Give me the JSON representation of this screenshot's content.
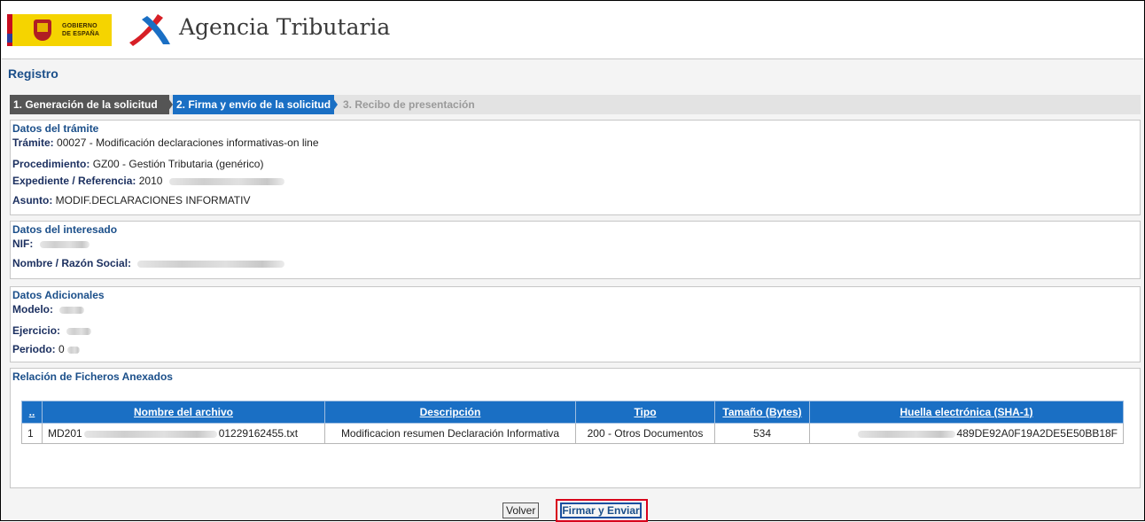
{
  "header": {
    "gov_text": [
      "GOBIERNO",
      "DE ESPAÑA"
    ],
    "brand": "Agencia Tributaria",
    "brand_color": "#1a6fc4"
  },
  "page_title": "Registro",
  "steps": [
    {
      "label": "1. Generación de la solicitud",
      "state": "done"
    },
    {
      "label": "2. Firma y envío de la solicitud",
      "state": "active"
    },
    {
      "label": "3. Recibo de presentación",
      "state": "pending"
    }
  ],
  "tramite": {
    "title": "Datos del trámite",
    "tramite_label": "Trámite:",
    "tramite_value": "00027 - Modificación declaraciones informativas-on line",
    "procedimiento_label": "Procedimiento:",
    "procedimiento_value": "GZ00 - Gestión Tributaria (genérico)",
    "expediente_label": "Expediente / Referencia:",
    "expediente_value": "2010",
    "asunto_label": "Asunto:",
    "asunto_value": "MODIF.DECLARACIONES INFORMATIV"
  },
  "interesado": {
    "title": "Datos del interesado",
    "nif_label": "NIF:",
    "nombre_label": "Nombre / Razón Social:"
  },
  "adicionales": {
    "title": "Datos Adicionales",
    "modelo_label": "Modelo:",
    "ejercicio_label": "Ejercicio:",
    "periodo_label": "Periodo:",
    "periodo_value": "0"
  },
  "ficheros": {
    "title": "Relación de Ficheros Anexados",
    "columns": [
      "..",
      "Nombre del archivo",
      "Descripción",
      "Tipo",
      "Tamaño (Bytes)",
      "Huella electrónica (SHA-1)"
    ],
    "rows": [
      {
        "num": "1",
        "name_prefix": "MD201",
        "name_suffix": "01229162455.txt",
        "descripcion": "Modificacion resumen Declaración Informativa",
        "tipo": "200 - Otros Documentos",
        "tamano": "534",
        "huella": "489DE92A0F19A2DE5E50BB18F"
      }
    ]
  },
  "buttons": {
    "volver": "Volver",
    "firmar": "Firmar y Enviar"
  },
  "colors": {
    "highlight": "#d8001c",
    "active_step": "#1a6fc4",
    "done_step": "#555555"
  }
}
